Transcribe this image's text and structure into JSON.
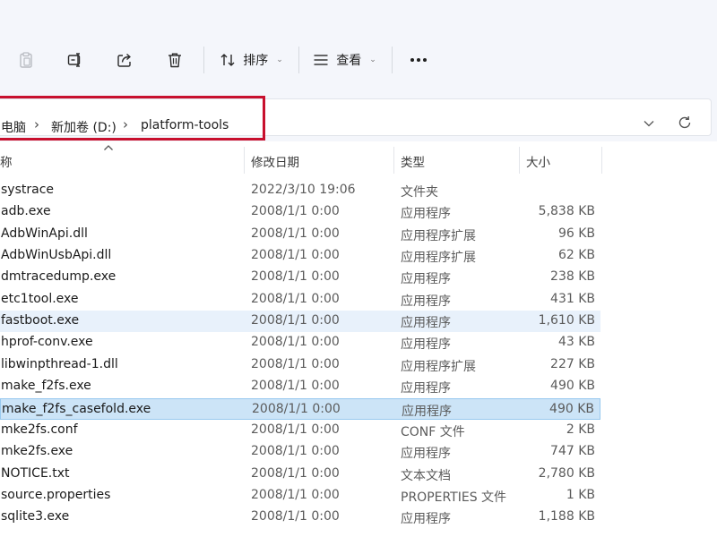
{
  "toolbar": {
    "sort_label": "排序",
    "view_label": "查看",
    "more_label": "更多"
  },
  "breadcrumb": [
    "电脑",
    "新加卷 (D:)",
    "platform-tools"
  ],
  "columns": {
    "name": "称",
    "modified": "修改日期",
    "type": "类型",
    "size": "大小"
  },
  "files": [
    {
      "name": "systrace",
      "modified": "2022/3/10 19:06",
      "type": "文件夹",
      "size": ""
    },
    {
      "name": "adb.exe",
      "modified": "2008/1/1 0:00",
      "type": "应用程序",
      "size": "5,838 KB"
    },
    {
      "name": "AdbWinApi.dll",
      "modified": "2008/1/1 0:00",
      "type": "应用程序扩展",
      "size": "96 KB"
    },
    {
      "name": "AdbWinUsbApi.dll",
      "modified": "2008/1/1 0:00",
      "type": "应用程序扩展",
      "size": "62 KB"
    },
    {
      "name": "dmtracedump.exe",
      "modified": "2008/1/1 0:00",
      "type": "应用程序",
      "size": "238 KB"
    },
    {
      "name": "etc1tool.exe",
      "modified": "2008/1/1 0:00",
      "type": "应用程序",
      "size": "431 KB"
    },
    {
      "name": "fastboot.exe",
      "modified": "2008/1/1 0:00",
      "type": "应用程序",
      "size": "1,610 KB"
    },
    {
      "name": "hprof-conv.exe",
      "modified": "2008/1/1 0:00",
      "type": "应用程序",
      "size": "43 KB"
    },
    {
      "name": "libwinpthread-1.dll",
      "modified": "2008/1/1 0:00",
      "type": "应用程序扩展",
      "size": "227 KB"
    },
    {
      "name": "make_f2fs.exe",
      "modified": "2008/1/1 0:00",
      "type": "应用程序",
      "size": "490 KB"
    },
    {
      "name": "make_f2fs_casefold.exe",
      "modified": "2008/1/1 0:00",
      "type": "应用程序",
      "size": "490 KB"
    },
    {
      "name": "mke2fs.conf",
      "modified": "2008/1/1 0:00",
      "type": "CONF 文件",
      "size": "2 KB"
    },
    {
      "name": "mke2fs.exe",
      "modified": "2008/1/1 0:00",
      "type": "应用程序",
      "size": "747 KB"
    },
    {
      "name": "NOTICE.txt",
      "modified": "2008/1/1 0:00",
      "type": "文本文档",
      "size": "2,780 KB"
    },
    {
      "name": "source.properties",
      "modified": "2008/1/1 0:00",
      "type": "PROPERTIES 文件",
      "size": "1 KB"
    },
    {
      "name": "sqlite3.exe",
      "modified": "2008/1/1 0:00",
      "type": "应用程序",
      "size": "1,188 KB"
    }
  ],
  "hover_row": 6,
  "selected_row": 10,
  "colors": {
    "highlight_box": "#c8102e",
    "hover": "#e8f1fb",
    "selected": "#cce4f7",
    "selected_border": "#99c9ef"
  }
}
